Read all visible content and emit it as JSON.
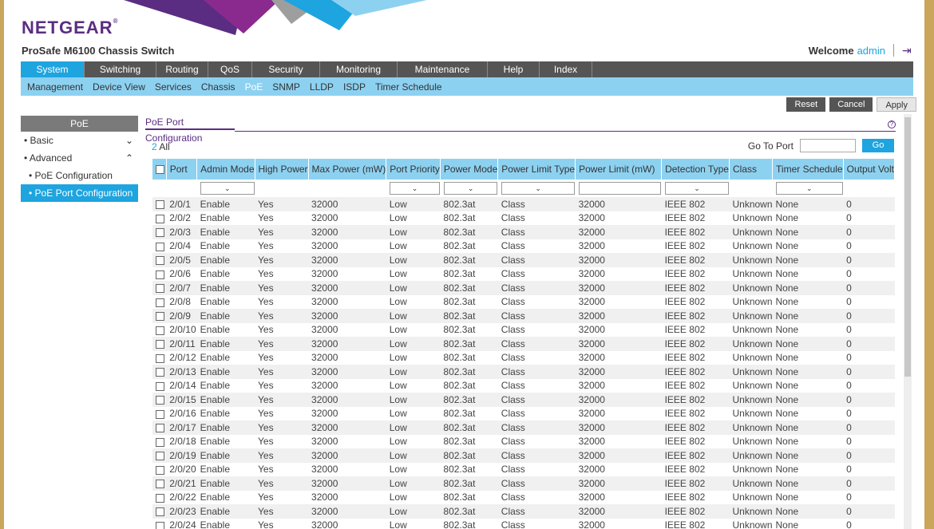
{
  "header": {
    "logo": "NETGEAR",
    "logo_mark": "®",
    "product": "ProSafe M6100 Chassis Switch",
    "welcome": "Welcome",
    "user": "admin"
  },
  "mainnav": [
    {
      "label": "System",
      "active": true,
      "w": 80
    },
    {
      "label": "Switching",
      "w": 90
    },
    {
      "label": "Routing",
      "w": 65
    },
    {
      "label": "QoS",
      "w": 55
    },
    {
      "label": "Security",
      "w": 85
    },
    {
      "label": "Monitoring",
      "w": 97
    },
    {
      "label": "Maintenance",
      "w": 113
    },
    {
      "label": "Help",
      "w": 65
    },
    {
      "label": "Index",
      "w": 66
    }
  ],
  "subnav": [
    {
      "label": "Management"
    },
    {
      "label": "Device View"
    },
    {
      "label": "Services"
    },
    {
      "label": "Chassis"
    },
    {
      "label": "PoE",
      "active": true
    },
    {
      "label": "SNMP"
    },
    {
      "label": "LLDP"
    },
    {
      "label": "ISDP"
    },
    {
      "label": "Timer Schedule"
    }
  ],
  "actions": {
    "reset": "Reset",
    "cancel": "Cancel",
    "apply": "Apply"
  },
  "sidebar": {
    "title": "PoE",
    "basic": "Basic",
    "advanced": "Advanced",
    "items": [
      "PoE Configuration",
      "PoE Port Configuration"
    ]
  },
  "content": {
    "title": "PoE Port Configuration",
    "count": "2",
    "all": "All",
    "goto_label": "Go To Port",
    "go": "Go"
  },
  "table": {
    "headers": [
      "Port",
      "Admin Mode",
      "High Power",
      "Max Power (mW)",
      "Port Priority",
      "Power Mode",
      "Power Limit Type",
      "Power Limit (mW)",
      "Detection Type",
      "Class",
      "Timer Schedule",
      "Output Volt"
    ],
    "rows": [
      [
        "2/0/1",
        "Enable",
        "Yes",
        "32000",
        "Low",
        "802.3at",
        "Class",
        "32000",
        "IEEE 802",
        "Unknown",
        "None",
        "0"
      ],
      [
        "2/0/2",
        "Enable",
        "Yes",
        "32000",
        "Low",
        "802.3at",
        "Class",
        "32000",
        "IEEE 802",
        "Unknown",
        "None",
        "0"
      ],
      [
        "2/0/3",
        "Enable",
        "Yes",
        "32000",
        "Low",
        "802.3at",
        "Class",
        "32000",
        "IEEE 802",
        "Unknown",
        "None",
        "0"
      ],
      [
        "2/0/4",
        "Enable",
        "Yes",
        "32000",
        "Low",
        "802.3at",
        "Class",
        "32000",
        "IEEE 802",
        "Unknown",
        "None",
        "0"
      ],
      [
        "2/0/5",
        "Enable",
        "Yes",
        "32000",
        "Low",
        "802.3at",
        "Class",
        "32000",
        "IEEE 802",
        "Unknown",
        "None",
        "0"
      ],
      [
        "2/0/6",
        "Enable",
        "Yes",
        "32000",
        "Low",
        "802.3at",
        "Class",
        "32000",
        "IEEE 802",
        "Unknown",
        "None",
        "0"
      ],
      [
        "2/0/7",
        "Enable",
        "Yes",
        "32000",
        "Low",
        "802.3at",
        "Class",
        "32000",
        "IEEE 802",
        "Unknown",
        "None",
        "0"
      ],
      [
        "2/0/8",
        "Enable",
        "Yes",
        "32000",
        "Low",
        "802.3at",
        "Class",
        "32000",
        "IEEE 802",
        "Unknown",
        "None",
        "0"
      ],
      [
        "2/0/9",
        "Enable",
        "Yes",
        "32000",
        "Low",
        "802.3at",
        "Class",
        "32000",
        "IEEE 802",
        "Unknown",
        "None",
        "0"
      ],
      [
        "2/0/10",
        "Enable",
        "Yes",
        "32000",
        "Low",
        "802.3at",
        "Class",
        "32000",
        "IEEE 802",
        "Unknown",
        "None",
        "0"
      ],
      [
        "2/0/11",
        "Enable",
        "Yes",
        "32000",
        "Low",
        "802.3at",
        "Class",
        "32000",
        "IEEE 802",
        "Unknown",
        "None",
        "0"
      ],
      [
        "2/0/12",
        "Enable",
        "Yes",
        "32000",
        "Low",
        "802.3at",
        "Class",
        "32000",
        "IEEE 802",
        "Unknown",
        "None",
        "0"
      ],
      [
        "2/0/13",
        "Enable",
        "Yes",
        "32000",
        "Low",
        "802.3at",
        "Class",
        "32000",
        "IEEE 802",
        "Unknown",
        "None",
        "0"
      ],
      [
        "2/0/14",
        "Enable",
        "Yes",
        "32000",
        "Low",
        "802.3at",
        "Class",
        "32000",
        "IEEE 802",
        "Unknown",
        "None",
        "0"
      ],
      [
        "2/0/15",
        "Enable",
        "Yes",
        "32000",
        "Low",
        "802.3at",
        "Class",
        "32000",
        "IEEE 802",
        "Unknown",
        "None",
        "0"
      ],
      [
        "2/0/16",
        "Enable",
        "Yes",
        "32000",
        "Low",
        "802.3at",
        "Class",
        "32000",
        "IEEE 802",
        "Unknown",
        "None",
        "0"
      ],
      [
        "2/0/17",
        "Enable",
        "Yes",
        "32000",
        "Low",
        "802.3at",
        "Class",
        "32000",
        "IEEE 802",
        "Unknown",
        "None",
        "0"
      ],
      [
        "2/0/18",
        "Enable",
        "Yes",
        "32000",
        "Low",
        "802.3at",
        "Class",
        "32000",
        "IEEE 802",
        "Unknown",
        "None",
        "0"
      ],
      [
        "2/0/19",
        "Enable",
        "Yes",
        "32000",
        "Low",
        "802.3at",
        "Class",
        "32000",
        "IEEE 802",
        "Unknown",
        "None",
        "0"
      ],
      [
        "2/0/20",
        "Enable",
        "Yes",
        "32000",
        "Low",
        "802.3at",
        "Class",
        "32000",
        "IEEE 802",
        "Unknown",
        "None",
        "0"
      ],
      [
        "2/0/21",
        "Enable",
        "Yes",
        "32000",
        "Low",
        "802.3at",
        "Class",
        "32000",
        "IEEE 802",
        "Unknown",
        "None",
        "0"
      ],
      [
        "2/0/22",
        "Enable",
        "Yes",
        "32000",
        "Low",
        "802.3at",
        "Class",
        "32000",
        "IEEE 802",
        "Unknown",
        "None",
        "0"
      ],
      [
        "2/0/23",
        "Enable",
        "Yes",
        "32000",
        "Low",
        "802.3at",
        "Class",
        "32000",
        "IEEE 802",
        "Unknown",
        "None",
        "0"
      ],
      [
        "2/0/24",
        "Enable",
        "Yes",
        "32000",
        "Low",
        "802.3at",
        "Class",
        "32000",
        "IEEE 802",
        "Unknown",
        "None",
        "0"
      ]
    ]
  },
  "colors": {
    "brand": "#5a2d82",
    "accent": "#1ea4df",
    "subnav": "#8dd1f1",
    "nav": "#555555"
  }
}
